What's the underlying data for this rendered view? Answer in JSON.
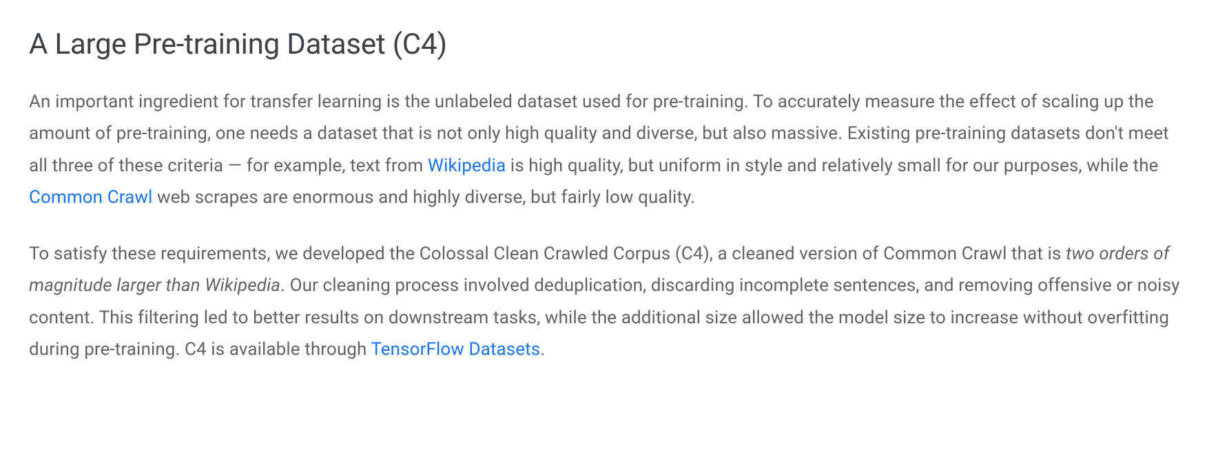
{
  "heading": "A Large Pre-training Dataset (C4)",
  "paragraphs": {
    "p1": {
      "t1": "An important ingredient for transfer learning is the unlabeled dataset used for pre-training. To accurately measure the effect of scaling up the amount of pre-training, one needs a dataset that is not only high quality and diverse, but also massive. Existing pre-training datasets don't meet all three of these criteria — for example, text from ",
      "link_wikipedia": "Wikipedia",
      "t2": " is high quality, but uniform in style and relatively small for our purposes, while the ",
      "link_commoncrawl": "Common Crawl",
      "t3": " web scrapes are enormous and highly diverse, but fairly low quality."
    },
    "p2": {
      "t1": "To satisfy these requirements, we developed the Colossal Clean Crawled Corpus (C4), a cleaned version of Common Crawl that is ",
      "italic": "two orders of magnitude larger than Wikipedia",
      "t2": ". Our cleaning process involved deduplication, discarding incomplete sentences, and removing offensive or noisy content. This filtering led to better results on downstream tasks, while the additional size allowed the model size to increase without overfitting during pre-training. C4 is available through ",
      "link_tfds": "TensorFlow Datasets",
      "t3": "."
    }
  }
}
